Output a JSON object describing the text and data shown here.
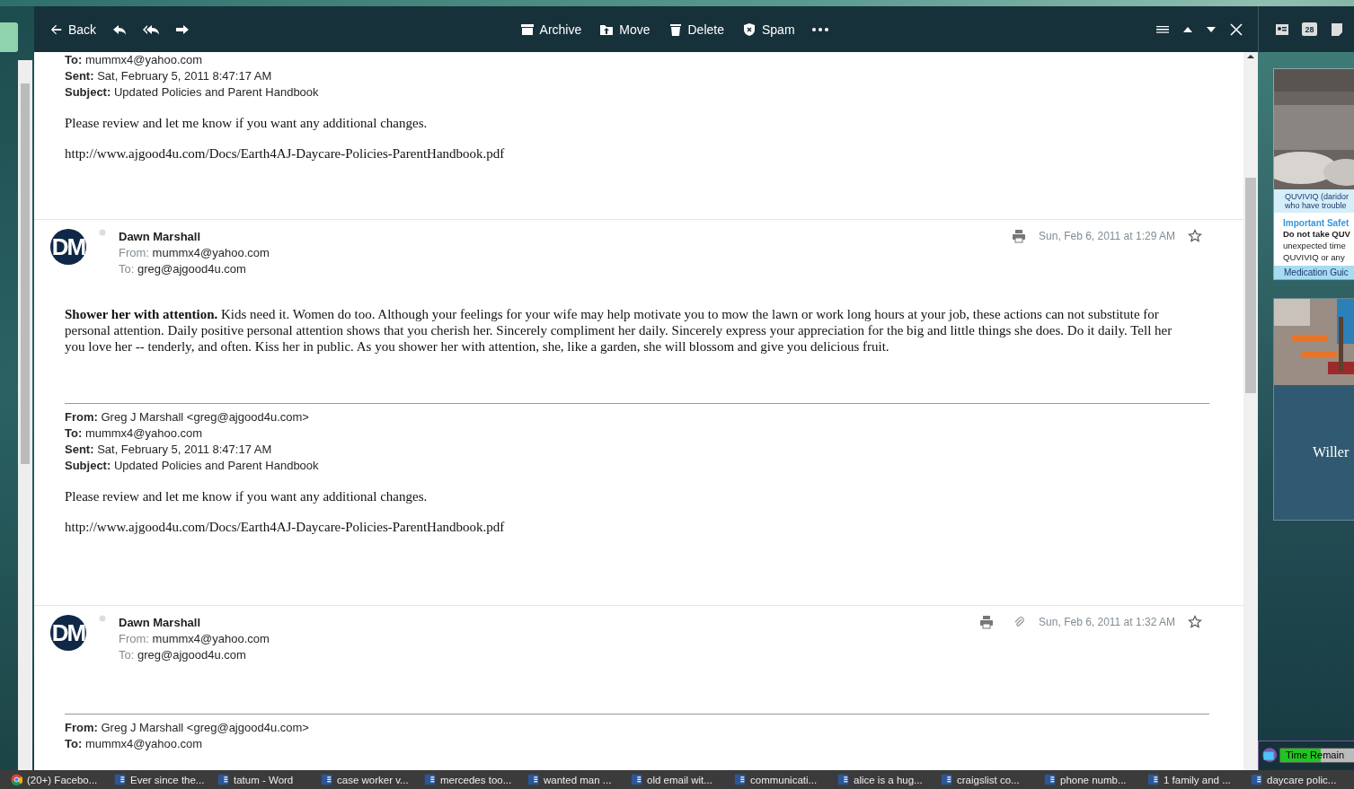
{
  "toolbar": {
    "back": "Back",
    "actions": [
      {
        "kind": "archive",
        "label": "Archive"
      },
      {
        "kind": "move",
        "label": "Move"
      },
      {
        "kind": "delete",
        "label": "Delete"
      },
      {
        "kind": "spam",
        "label": "Spam"
      }
    ]
  },
  "side_toolbar": {
    "calendar_day": "28"
  },
  "thread": [
    {
      "kind": "quote",
      "headers": [
        {
          "label": "To:",
          "value": "mummx4@yahoo.com"
        },
        {
          "label": "Sent:",
          "value": "Sat, February 5, 2011 8:47:17 AM"
        },
        {
          "label": "Subject:",
          "value": "Updated Policies and Parent Handbook"
        }
      ],
      "body": "Please review and let me know if you want any additional changes.",
      "link": "http://www.ajgood4u.com/Docs/Earth4AJ-Daycare-Policies-ParentHandbook.pdf"
    },
    {
      "kind": "message",
      "initials": "DM",
      "sender": "Dawn Marshall",
      "from_label": "From:",
      "from": "mummx4@yahoo.com",
      "to_label": "To:",
      "to": "greg@ajgood4u.com",
      "date": "Sun, Feb 6, 2011 at 1:29 AM",
      "attachment": false,
      "starred": false,
      "body": "**Shower her with attention.** Kids need it. Women do too. Although your feelings for your wife may help motivate you to mow the lawn or work long hours at your job, these actions can not substitute for personal attention. Daily positive personal attention shows that you cherish her. Sincerely compliment her daily. Sincerely express your appreciation for the big and little things she does. Do it daily. Tell her you love her -- tenderly, and often. Kiss her in public. As you shower her with attention, she, like a garden, she will blossom and give you delicious fruit.",
      "quote": {
        "headers": [
          {
            "label": "From:",
            "value": "Greg J Marshall <greg@ajgood4u.com>"
          },
          {
            "label": "To:",
            "value": "mummx4@yahoo.com"
          },
          {
            "label": "Sent:",
            "value": "Sat, February 5, 2011 8:47:17 AM"
          },
          {
            "label": "Subject:",
            "value": "Updated Policies and Parent Handbook"
          }
        ],
        "body": "Please review and let me know if you want any additional changes.",
        "link": "http://www.ajgood4u.com/Docs/Earth4AJ-Daycare-Policies-ParentHandbook.pdf"
      }
    },
    {
      "kind": "message",
      "initials": "DM",
      "sender": "Dawn Marshall",
      "from_label": "From:",
      "from": "mummx4@yahoo.com",
      "to_label": "To:",
      "to": "greg@ajgood4u.com",
      "date": "Sun, Feb 6, 2011 at 1:32 AM",
      "attachment": true,
      "starred": false,
      "quote": {
        "headers": [
          {
            "label": "From:",
            "value": "Greg J Marshall <greg@ajgood4u.com>"
          },
          {
            "label": "To:",
            "value": "mummx4@yahoo.com"
          }
        ]
      }
    }
  ],
  "ads": [
    {
      "kind": "pharma",
      "caption": [
        "QUVIVIQ (daridor",
        "who have trouble"
      ],
      "heading": "Important Safet",
      "lines": [
        "Do not take QUV",
        "unexpected time",
        "QUVIVIQ or any"
      ],
      "footer": "Medication Guic"
    },
    {
      "kind": "resort",
      "title": "Willer"
    }
  ],
  "timer": {
    "label": "Time Remain",
    "level": 0.55
  },
  "taskbar": [
    {
      "kind": "chrome",
      "label": "(20+) Facebo..."
    },
    {
      "kind": "word",
      "label": "Ever since the..."
    },
    {
      "kind": "word",
      "label": "tatum - Word"
    },
    {
      "kind": "word",
      "label": "case worker v..."
    },
    {
      "kind": "word",
      "label": "mercedes too..."
    },
    {
      "kind": "word",
      "label": "wanted man ..."
    },
    {
      "kind": "word",
      "label": "old email wit..."
    },
    {
      "kind": "word",
      "label": "communicati..."
    },
    {
      "kind": "word",
      "label": "alice is a hug..."
    },
    {
      "kind": "word",
      "label": "craigslist co..."
    },
    {
      "kind": "word",
      "label": "phone numb..."
    },
    {
      "kind": "word",
      "label": "1 family and ..."
    },
    {
      "kind": "word",
      "label": "daycare polic..."
    }
  ]
}
